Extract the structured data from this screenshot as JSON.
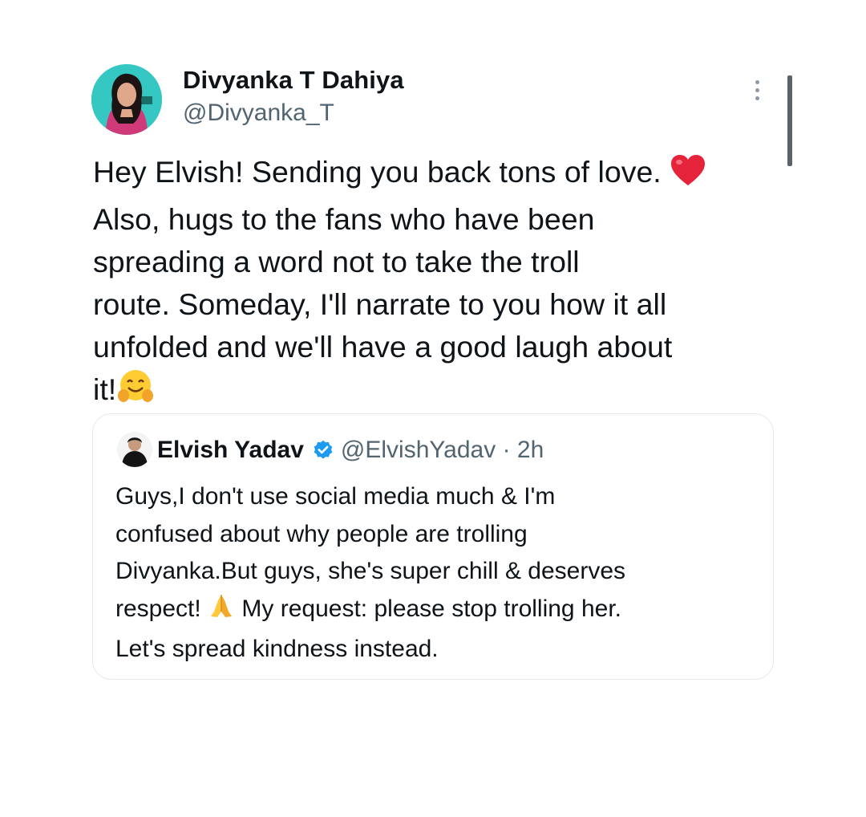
{
  "tweet": {
    "author_name": "Divyanka T Dahiya",
    "author_handle": "@Divyanka_T",
    "text_lines": [
      "Hey Elvish! Sending you back tons of love.",
      "Also, hugs to the fans who have been",
      "spreading a word not to take the troll",
      "route. Someday, I'll narrate to you how it all",
      "unfolded and we'll have a good laugh about",
      "it!"
    ],
    "emojis": [
      "red-heart",
      "hugging-face"
    ]
  },
  "quoted_tweet": {
    "author_name": "Elvish Yadav",
    "author_handle": "@ElvishYadav",
    "separator": "·",
    "time": "2h",
    "text_lines": [
      "Guys,I don't use social media much & I'm",
      "confused about why people are trolling",
      "Divyanka.But guys, she's super chill & deserves",
      "respect!",
      "My request: please stop trolling her.",
      "Let's spread kindness instead."
    ],
    "emojis": [
      "folded-hands"
    ]
  },
  "icons": {
    "more": "more-vertical-icon",
    "verified": "verified-badge-icon"
  },
  "colors": {
    "text_primary": "#0f1419",
    "text_secondary": "#536471",
    "verified_blue": "#1d9bf0",
    "quote_border": "#e4e9ed",
    "avatar_bg": "#2fc4c0"
  }
}
